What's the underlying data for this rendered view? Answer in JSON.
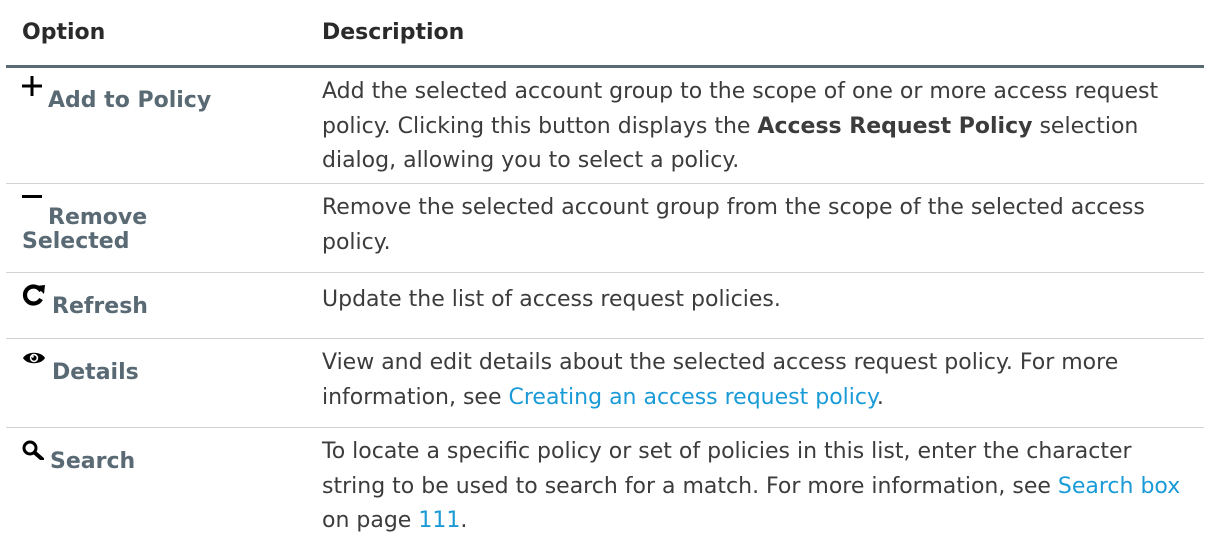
{
  "header": {
    "option": "Option",
    "description": "Description"
  },
  "rows": [
    {
      "icon": "plus-icon",
      "label": "Add to Policy",
      "desc_1": "Add the selected account group to the scope of one or more access request policy. Clicking this button displays the ",
      "bold": "Access Request Policy",
      "desc_2": " selection dialog, allowing you to select a policy."
    },
    {
      "icon": "minus-icon",
      "label_1": "Remove",
      "label_2": "Selected",
      "desc": "Remove the selected account group from the scope of the selected access policy."
    },
    {
      "icon": "refresh-icon",
      "label": "Refresh",
      "desc": "Update the list of access request policies."
    },
    {
      "icon": "eye-icon",
      "label": "Details",
      "desc_1": "View and edit details about the selected access request policy. For more information, see ",
      "link": "Creating an access request policy",
      "desc_2": "."
    },
    {
      "icon": "search-icon",
      "label": "Search",
      "desc_1": "To locate a specific policy or set of policies in this list, enter the character string to be used to search for a match. For more information, see ",
      "link": "Search box",
      "desc_2": " on page ",
      "page_link": "111",
      "desc_3": "."
    }
  ]
}
